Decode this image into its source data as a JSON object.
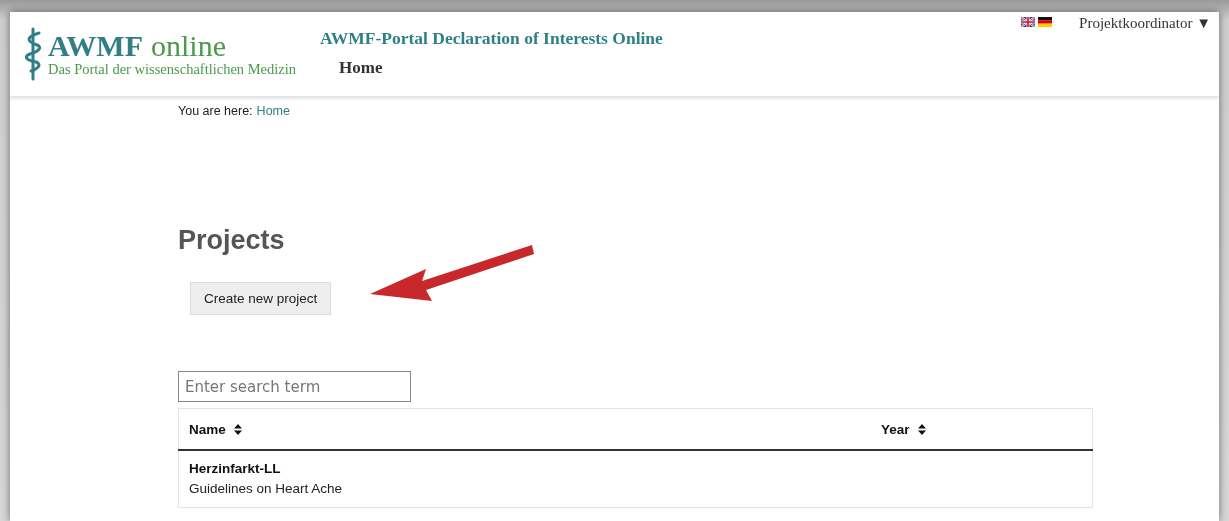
{
  "header": {
    "logo": {
      "title_main": "AWMF",
      "title_rest": "online",
      "subtitle": "Das Portal der wissenschaftlichen Medizin"
    },
    "portal_title": "AWMF-Portal Declaration of Interests Online",
    "nav": [
      {
        "label": "Home"
      }
    ],
    "user_menu": "Projektkoordinator ▼"
  },
  "breadcrumb": {
    "prefix": "You are here:",
    "link": "Home"
  },
  "heading": "Projects",
  "create_button": "Create new project",
  "search": {
    "placeholder": "Enter search term"
  },
  "table": {
    "columns": [
      "Name",
      "Year"
    ],
    "rows": [
      {
        "name": "Herzinfarkt-LL",
        "description": "Guidelines on Heart Ache"
      }
    ]
  }
}
